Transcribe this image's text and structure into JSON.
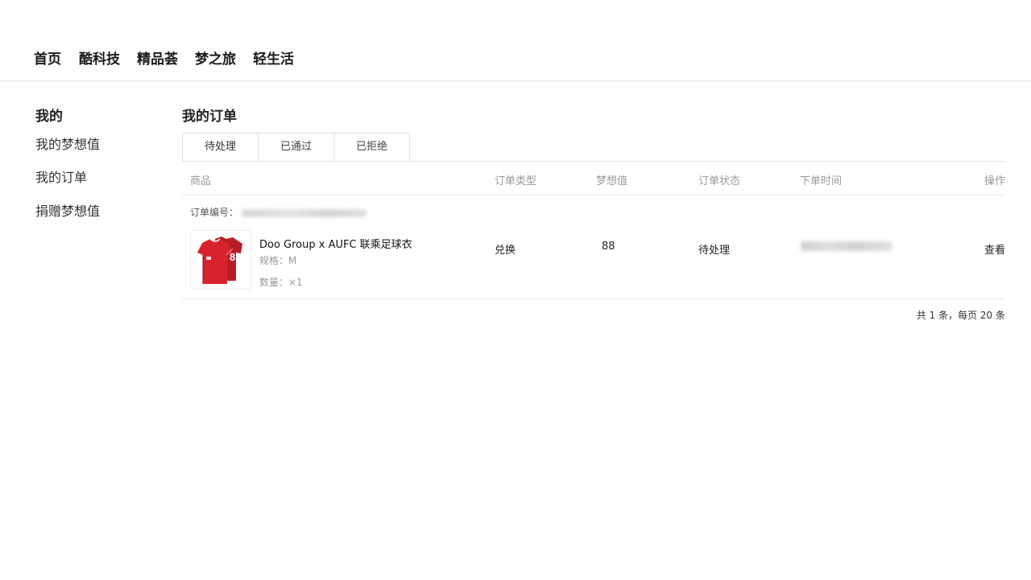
{
  "nav": {
    "items": [
      "首页",
      "酷科技",
      "精品荟",
      "梦之旅",
      "轻生活"
    ]
  },
  "sidebar": {
    "title": "我的",
    "items": [
      "我的梦想值",
      "我的订单",
      "捐赠梦想值"
    ]
  },
  "main": {
    "title": "我的订单",
    "tabs": [
      "待处理",
      "已通过",
      "已拒绝"
    ],
    "active_tab": "待处理",
    "columns": [
      "商品",
      "订单类型",
      "梦想值",
      "订单状态",
      "下单时间",
      "操作"
    ],
    "order": {
      "number_label": "订单编号：",
      "product_name": "Doo Group x AUFC 联乘足球衣",
      "spec": "规格：M",
      "quantity": "数量：×1",
      "type": "兑换",
      "points": "88",
      "status": "待处理",
      "action": "查看",
      "jersey_number": "8"
    },
    "pagination": "共 1 条，每页 20 条"
  },
  "colors": {
    "jersey_red": "#d8232f",
    "border": "#e8e8e8",
    "muted_text": "#999999"
  }
}
